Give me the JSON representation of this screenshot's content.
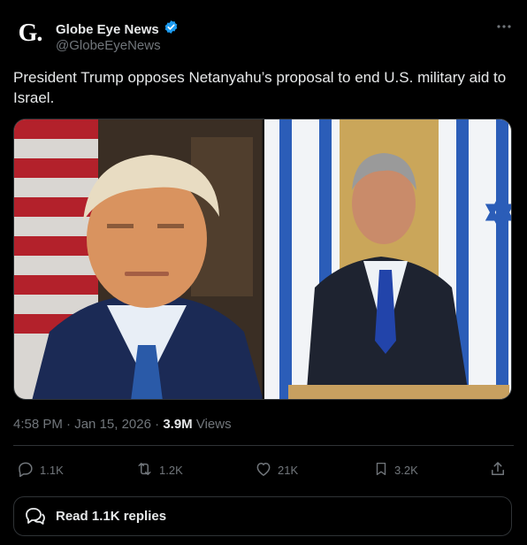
{
  "account": {
    "avatar_letter": "G.",
    "display_name": "Globe Eye News",
    "handle": "@GlobeEyeNews"
  },
  "post": {
    "text": "President Trump opposes Netanyahu’s proposal to end U.S. military aid to Israel.",
    "time": "4:58 PM",
    "date": "Jan 15, 2026",
    "views_count": "3.9M",
    "views_label": "Views"
  },
  "actions": {
    "replies": "1.1K",
    "reposts": "1.2K",
    "likes": "21K",
    "bookmarks": "3.2K"
  },
  "read_replies_label": "Read 1.1K replies",
  "colors": {
    "background": "#000000",
    "text_primary": "#e7e9ea",
    "text_secondary": "#71767b",
    "verified_blue": "#1d9bf0",
    "border": "#2f3336"
  }
}
